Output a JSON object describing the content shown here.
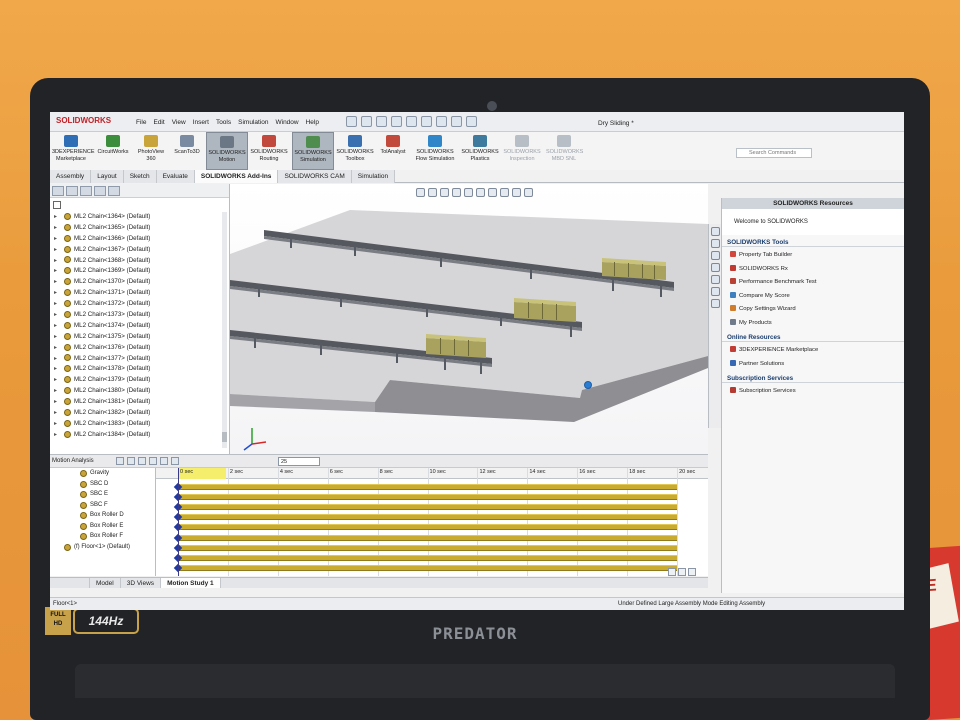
{
  "device": {
    "badge_full": "FULL",
    "badge_hd": "HD",
    "refresh_rate": "144Hz",
    "brand": "PREDATOR",
    "box_text": "SE"
  },
  "app": {
    "logo": "SOLIDWORKS",
    "menus": [
      "File",
      "Edit",
      "View",
      "Insert",
      "Tools",
      "Simulation",
      "Window",
      "Help"
    ],
    "document_title": "Dry Sliding *",
    "search_placeholder": "Search Commands"
  },
  "ribbon": [
    {
      "label": "3DEXPERIENCE Marketplace",
      "icon": "3dexperience-icon",
      "color": "#2f6db5"
    },
    {
      "label": "CircuitWorks",
      "icon": "circuitworks-icon",
      "color": "#3c8d3c"
    },
    {
      "label": "PhotoView 360",
      "icon": "photoview-icon",
      "color": "#c9a43a"
    },
    {
      "label": "ScanTo3D",
      "icon": "scanto3d-icon",
      "color": "#7a8aa0"
    },
    {
      "label": "SOLIDWORKS Motion",
      "icon": "motion-icon",
      "color": "#6b7785"
    },
    {
      "label": "SOLIDWORKS Routing",
      "icon": "routing-icon",
      "color": "#c2483d"
    },
    {
      "label": "SOLIDWORKS Simulation",
      "icon": "simulation-icon",
      "color": "#4f8d4f"
    },
    {
      "label": "SOLIDWORKS Toolbox",
      "icon": "toolbox-icon",
      "color": "#3a6fb0"
    },
    {
      "label": "TolAnalyst",
      "icon": "tolanalyst-icon",
      "color": "#c24a3c"
    },
    {
      "label": "SOLIDWORKS Flow Simulation",
      "icon": "flow-simulation-icon",
      "color": "#2f86c9"
    },
    {
      "label": "SOLIDWORKS Plastics",
      "icon": "plastics-icon",
      "color": "#3d7a9e"
    },
    {
      "label": "SOLIDWORKS Inspection",
      "icon": "inspection-icon",
      "color": "#b8bec6"
    },
    {
      "label": "SOLIDWORKS MBD SNL",
      "icon": "mbd-icon",
      "color": "#b8bec6"
    }
  ],
  "tabs": [
    "Assembly",
    "Layout",
    "Sketch",
    "Evaluate",
    "SOLIDWORKS Add-Ins",
    "SOLIDWORKS CAM",
    "Simulation"
  ],
  "feature_tree": [
    "ML2 Chain<1364> (Default)",
    "ML2 Chain<1365> (Default)",
    "ML2 Chain<1366> (Default)",
    "ML2 Chain<1367> (Default)",
    "ML2 Chain<1368> (Default)",
    "ML2 Chain<1369> (Default)",
    "ML2 Chain<1370> (Default)",
    "ML2 Chain<1371> (Default)",
    "ML2 Chain<1372> (Default)",
    "ML2 Chain<1373> (Default)",
    "ML2 Chain<1374> (Default)",
    "ML2 Chain<1375> (Default)",
    "ML2 Chain<1376> (Default)",
    "ML2 Chain<1377> (Default)",
    "ML2 Chain<1378> (Default)",
    "ML2 Chain<1379> (Default)",
    "ML2 Chain<1380> (Default)",
    "ML2 Chain<1381> (Default)",
    "ML2 Chain<1382> (Default)",
    "ML2 Chain<1383> (Default)",
    "ML2 Chain<1384> (Default)"
  ],
  "taskpane": {
    "title": "SOLIDWORKS Resources",
    "welcome": "Welcome to SOLIDWORKS",
    "sections": [
      {
        "title": "SOLIDWORKS Tools",
        "items": [
          "Property Tab Builder",
          "SOLIDWORKS Rx",
          "Performance Benchmark Test",
          "Compare My Score",
          "Copy Settings Wizard",
          "My Products"
        ]
      },
      {
        "title": "Online Resources",
        "items": [
          "3DEXPERIENCE Marketplace",
          "Partner Solutions"
        ]
      },
      {
        "title": "Subscription Services",
        "items": [
          "Subscription Services"
        ]
      }
    ]
  },
  "motion": {
    "study_type": "Motion Analysis",
    "fps": "25",
    "tree": [
      "Gravity",
      "SBC D",
      "SBC E",
      "SBC F",
      "Box Roller D",
      "Box Roller E",
      "Box Roller F",
      "(f) Floor<1> (Default)"
    ],
    "time_labels": [
      "0 sec",
      "2 sec",
      "4 sec",
      "6 sec",
      "8 sec",
      "10 sec",
      "12 sec",
      "14 sec",
      "16 sec",
      "18 sec",
      "20 sec"
    ],
    "time_values": [
      0,
      2,
      4,
      6,
      8,
      10,
      12,
      14,
      16,
      18,
      20
    ],
    "duration_sec": 20,
    "bar_count": 9
  },
  "bottom_tabs": [
    "Model",
    "3D Views",
    "Motion Study 1"
  ],
  "status": {
    "left": "Floor<1>",
    "right": "Under Defined   Large Assembly Mode   Editing Assembly"
  }
}
